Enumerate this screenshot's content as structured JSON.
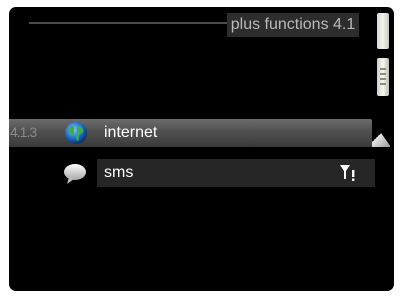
{
  "header": {
    "title": "plus functions 4.1"
  },
  "menu": {
    "items": [
      {
        "number": "4.1.3",
        "label": "internet",
        "icon": "globe-icon",
        "selected": true
      },
      {
        "number": "",
        "label": "sms",
        "icon": "chat-bubble-icon",
        "status_icon": "signal-warning-icon",
        "selected": false
      }
    ]
  },
  "colors": {
    "background": "#000000",
    "selected_row": "#505050",
    "row": "#262626",
    "text": "#ffffff",
    "title_text": "#b9b9b9"
  }
}
